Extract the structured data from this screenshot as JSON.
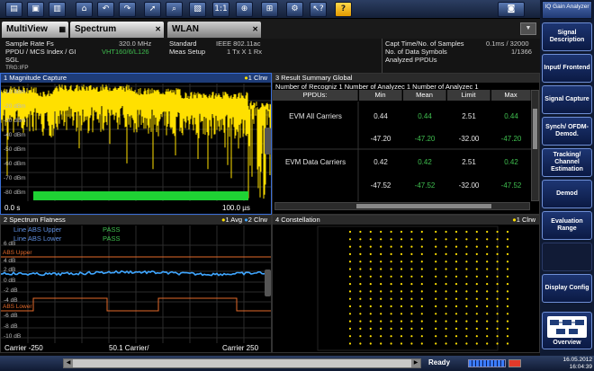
{
  "toolbar": {
    "buttons": [
      "folder-icon",
      "save-icon",
      "print-icon",
      "recall-icon",
      "undo-icon",
      "redo-icon",
      "pointer-icon",
      "zoom-icon",
      "zoom-area-icon",
      "zoom-1to1-icon",
      "multi-zoom-icon",
      "zoom-off-icon",
      "connect-icon",
      "context-help-icon",
      "help-icon"
    ],
    "help_label": "?",
    "context_help_label": "↖?",
    "zoom_1to1_label": "1:1"
  },
  "tabs": [
    {
      "label": "MultiView",
      "marker": "▦"
    },
    {
      "label": "Spectrum",
      "marker": "✕"
    },
    {
      "label": "WLAN",
      "marker": "✕"
    }
  ],
  "info": {
    "sample_rate_label": "Sample Rate Fs",
    "sample_rate_value": "320.0 MHz",
    "ppdu_label": "PPDU / MCS Index / GI",
    "ppdu_value": "VHT160/6/L126",
    "sgl": "SGL",
    "trg": "TRG:IFP",
    "standard_label": "Standard",
    "standard_value": "IEEE 802.11ac",
    "meas_setup_label": "Meas Setup",
    "meas_setup_value": "1 Tx X 1 Rx",
    "capt_label": "Capt Time/No. of Samples",
    "capt_value": "0.1ms / 32000",
    "symbols_label": "No. of Data Symbols",
    "symbols_value": "1/1366",
    "analyzed_label": "Analyzed PPDUs"
  },
  "mag": {
    "title": "1 Magnitude Capture",
    "legend": "1 Clrw",
    "y_ticks": [
      "-10 dBm",
      "-20 dBm",
      "-30 dBm",
      "-40 dBm",
      "-50 dBm",
      "-60 dBm",
      "-70 dBm",
      "-80 dBm"
    ],
    "x_start": "0.0 s",
    "x_end": "100.0 µs"
  },
  "summary": {
    "title": "3 Result Summary Global",
    "subheader": "Number of Recogniz 1   Number of Analyzec 1   Number of Analyzec 1",
    "columns": [
      "PPDUs:",
      "Min",
      "Mean",
      "Limit",
      "Max"
    ],
    "rows": [
      {
        "label": "EVM All Carriers",
        "pct": [
          "0.44",
          "0.44",
          "2.51",
          "0.44"
        ],
        "db": [
          "-47.20",
          "-47.20",
          "-32.00",
          "-47.20"
        ]
      },
      {
        "label": "EVM Data Carriers",
        "pct": [
          "0.42",
          "0.42",
          "2.51",
          "0.42"
        ],
        "db": [
          "-47.52",
          "-47.52",
          "-32.00",
          "-47.52"
        ]
      }
    ]
  },
  "flat": {
    "title": "2 Spectrum Flatness",
    "legend_1": "1 Avg",
    "legend_2": "2 Clrw",
    "line_upper_label": "Line ABS Upper",
    "line_upper_status": "PASS",
    "line_lower_label": "Line ABS Lower",
    "line_lower_status": "PASS",
    "limit_upper": "ABS Upper",
    "limit_lower": "ABS Lower",
    "y_ticks": [
      "6 dB",
      "4 dB",
      "2 dB",
      "0 dB",
      "-2 dB",
      "-4 dB",
      "-6 dB",
      "-8 dB",
      "-10 dB"
    ],
    "x_start": "Carrier -250",
    "x_mid": "50.1 Carrier/",
    "x_end": "Carrier 250"
  },
  "constellation": {
    "title": "4 Constellation",
    "legend": "1 Clrw"
  },
  "sidebar": {
    "header": "IQ Gain Analyzer",
    "softkeys": [
      "Signal Description",
      "Input/ Frontend",
      "Signal Capture",
      "Synch/ OFDM-Demod.",
      "Tracking/ Channel Estimation",
      "Demod",
      "Evaluation Range",
      "",
      "Display Config"
    ],
    "overview": "Overview"
  },
  "status": {
    "ready": "Ready",
    "date": "16.05.2012",
    "time": "16:04:39"
  },
  "colors": {
    "trace_yellow": "#ffe000",
    "burst_green": "#1fd234",
    "pass_green": "#3fbf4f",
    "limit_red": "#e46a2a",
    "trace_blue": "#3fa6ff"
  }
}
